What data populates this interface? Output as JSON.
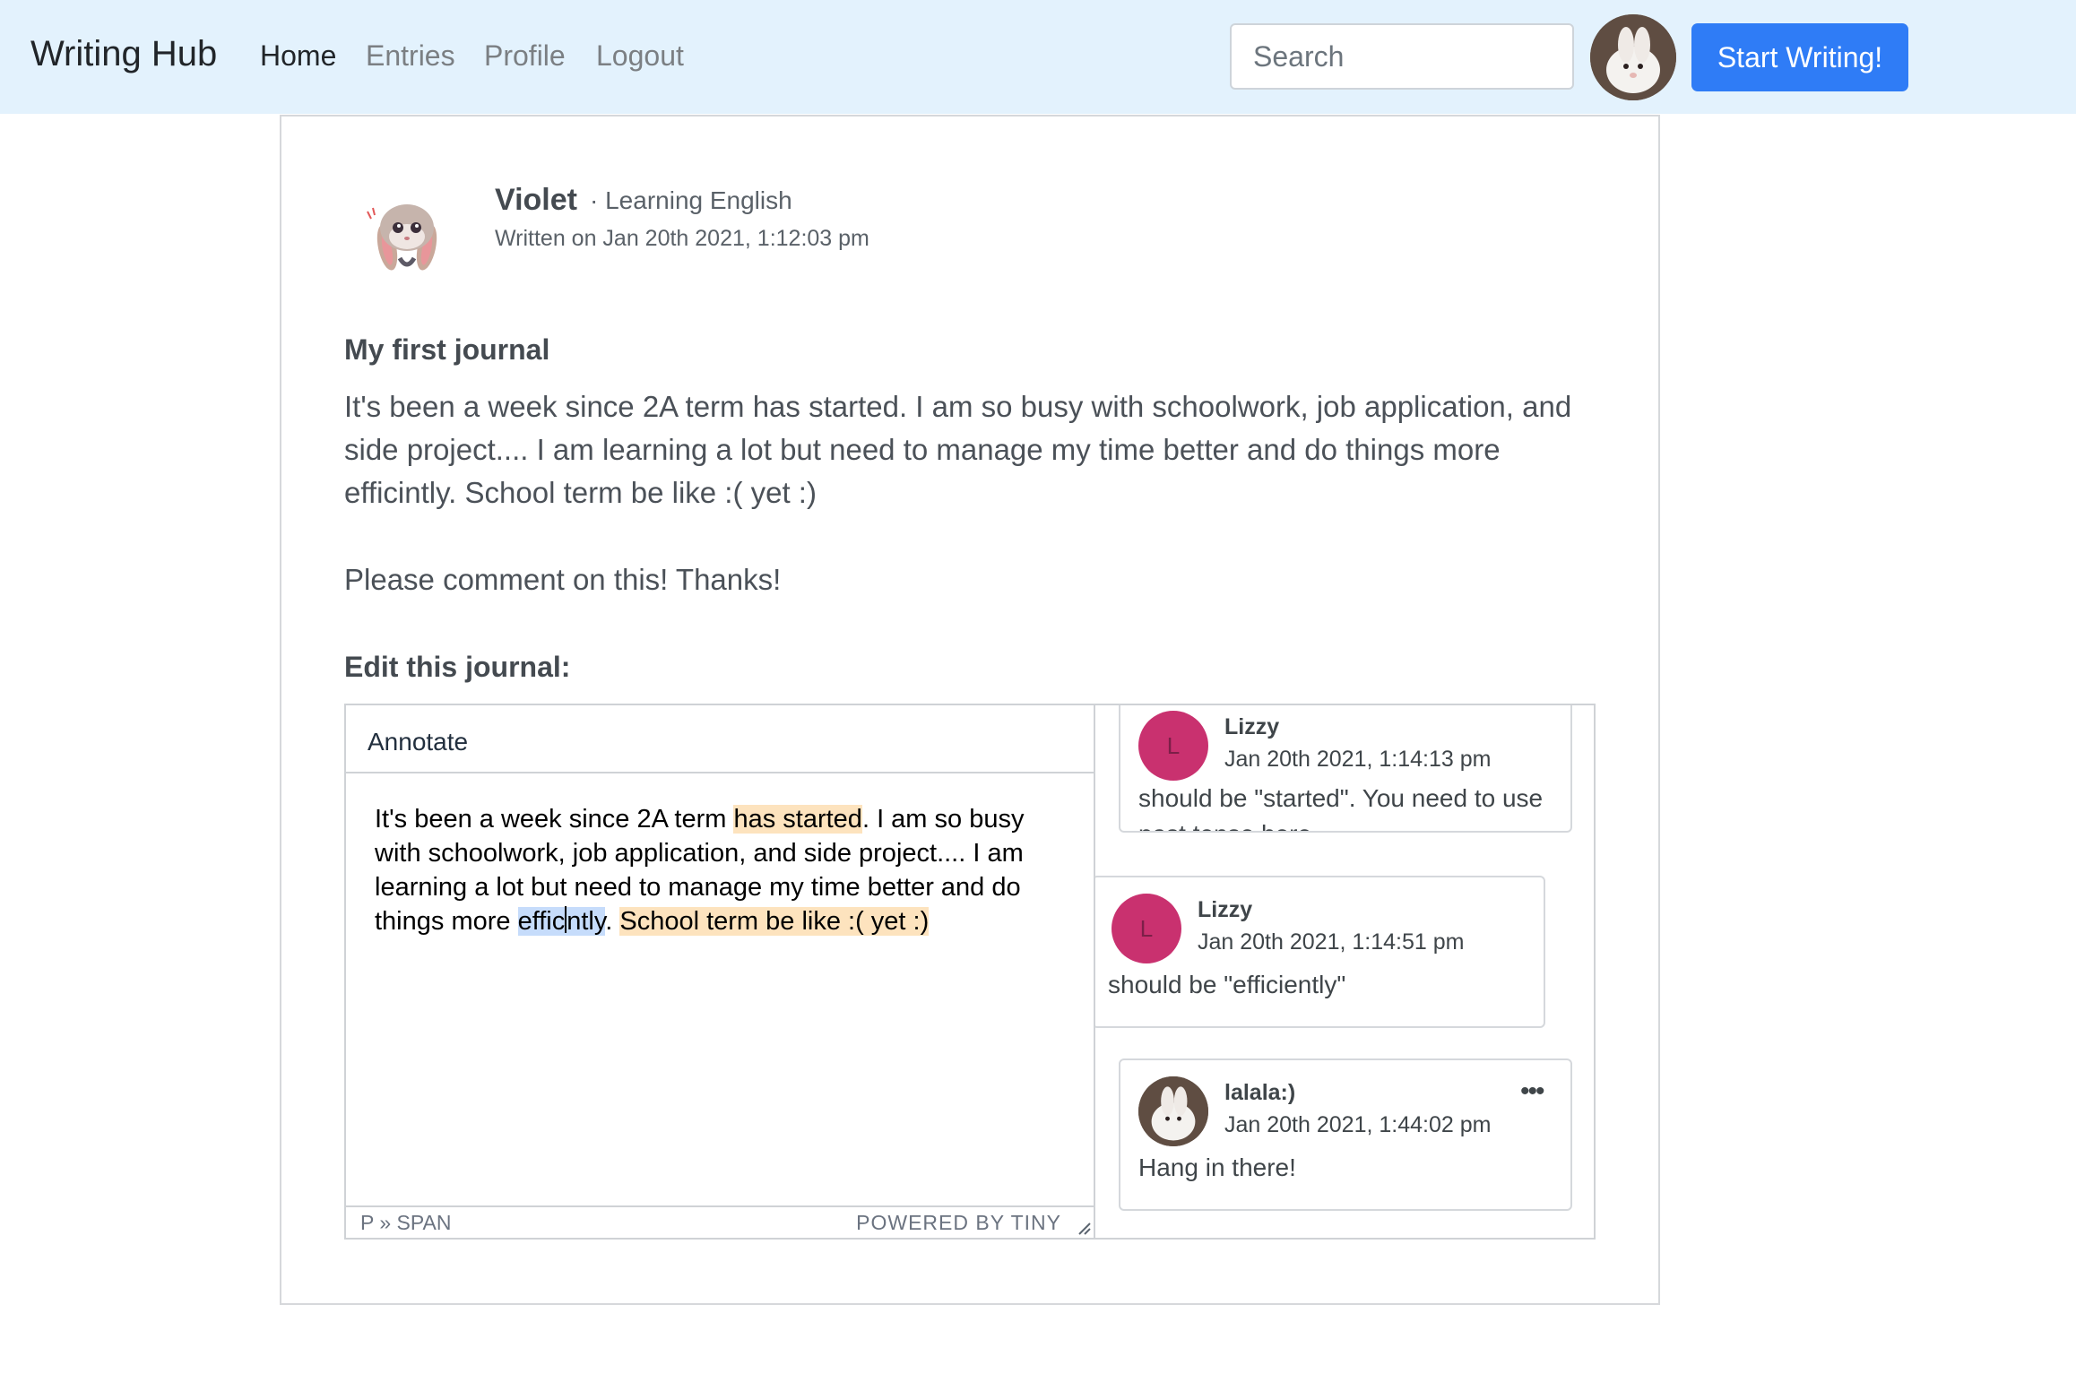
{
  "nav": {
    "brand": "Writing Hub",
    "links": [
      "Home",
      "Entries",
      "Profile",
      "Logout"
    ],
    "search_placeholder": "Search",
    "cta": "Start Writing!"
  },
  "entry": {
    "author": "Violet",
    "tag": "· Learning English",
    "date": "Written on Jan 20th 2021, 1:12:03 pm",
    "title": "My first journal",
    "body": "It's been a week since 2A term has started. I am so busy with schoolwork, job application, and side project.... I am learning a lot but need to manage my time better and do things more efficintly. School term be like :( yet :)",
    "footer": "Please comment on this! Thanks!"
  },
  "editor": {
    "heading": "Edit this journal:",
    "menu": "Annotate",
    "content": {
      "p1": "It's been a week since 2A term ",
      "hl1": "has started",
      "p2": ". I am so busy with schoolwork, job application, and side project.... I am learning a lot but need to manage my time better and do things more ",
      "sel_a": "effic",
      "sel_b": "ntly",
      "p3": ". ",
      "hl2": "School term be like :( yet :)"
    },
    "status_path": "P » SPAN",
    "status_brand": "POWERED BY TINY"
  },
  "comments": [
    {
      "initial": "L",
      "name": "Lizzy",
      "date": "Jan 20th 2021, 1:14:13 pm",
      "text": "should be \"started\". You need to use past tense here"
    },
    {
      "initial": "L",
      "name": "Lizzy",
      "date": "Jan 20th 2021, 1:14:51 pm",
      "text": "should be \"efficiently\""
    },
    {
      "initial": "",
      "name": "lalala:)",
      "date": "Jan 20th 2021, 1:44:02 pm",
      "text": "Hang in there!",
      "more": "•••"
    }
  ],
  "colors": {
    "navbar_bg": "#e3f2fd",
    "primary": "#2f7cf6",
    "annotation": "#fde3be",
    "selection": "#c6dcfb",
    "comment_avatar": "#c9316f"
  },
  "icons": {
    "nav_avatar": "bunny-avatar-icon",
    "author_avatar": "cartoon-bunny-avatar-icon",
    "more": "more-options-icon",
    "resize": "resize-handle-icon"
  }
}
